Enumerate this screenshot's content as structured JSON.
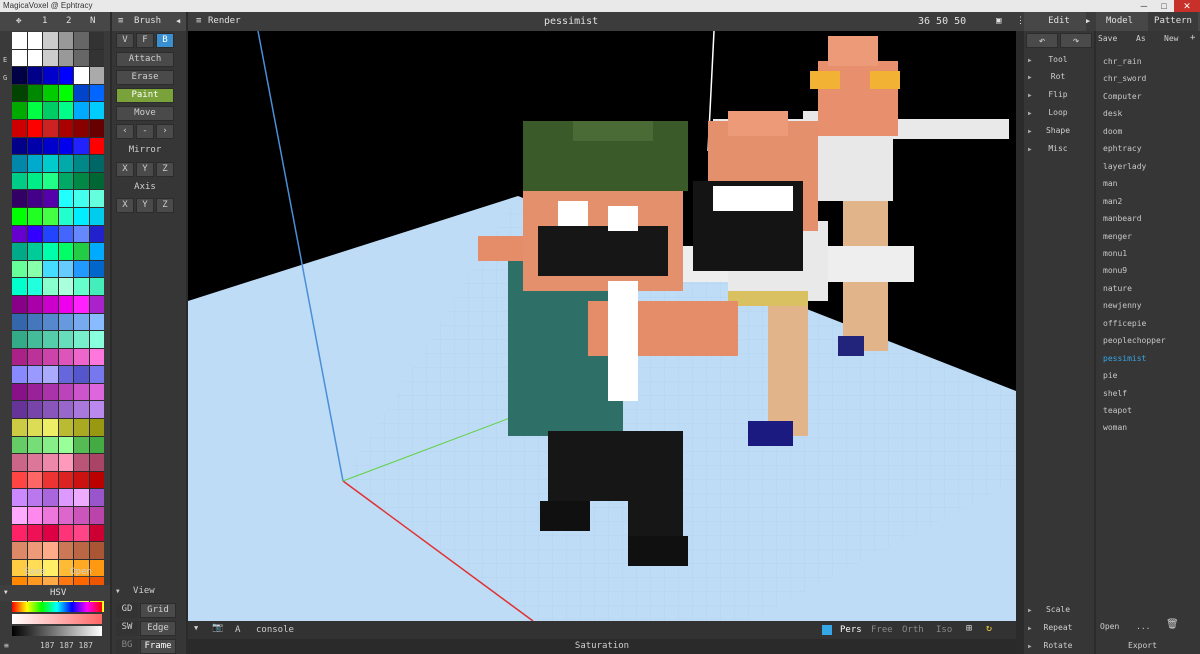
{
  "window": {
    "title": "MagicaVoxel @ Ephtracy",
    "min": "─",
    "max": "□",
    "close": "✕"
  },
  "top_left": {
    "move_icon": "✥",
    "tab1": "1",
    "tab2": "2",
    "tab_n": "N"
  },
  "side_letters": {
    "e": "E",
    "g": "G"
  },
  "brush": {
    "title": "Brush",
    "modes": [
      "V",
      "F",
      "B"
    ],
    "actions": [
      "Attach",
      "Erase",
      "Paint",
      "Move"
    ],
    "nav": [
      "‹",
      "-",
      "›"
    ],
    "mirror_label": "Mirror",
    "mirror_axes": [
      "X",
      "Y",
      "Z"
    ],
    "axis_label": "Axis",
    "axis_axes": [
      "X",
      "Y",
      "Z"
    ]
  },
  "palette": {
    "save": "Save",
    "open": "Open",
    "mode": "HSV",
    "rgb": "187 187 187",
    "colors": [
      "#ffffff",
      "#ffffff",
      "#cccccc",
      "#999999",
      "#666666",
      "#333333",
      "#ffffff",
      "#ffffff",
      "#cccccc",
      "#999999",
      "#666666",
      "#333333",
      "#000044",
      "#000088",
      "#0000cc",
      "#0000ff",
      "#ffffff",
      "#aaaaaa",
      "#004400",
      "#008800",
      "#00cc00",
      "#00ff00",
      "#0044cc",
      "#0066ff",
      "#00aa00",
      "#00ff44",
      "#00cc66",
      "#00ff88",
      "#00aaff",
      "#00ccff",
      "#cc0000",
      "#ff0000",
      "#cc2222",
      "#aa0000",
      "#880000",
      "#660000",
      "#000088",
      "#0000aa",
      "#0000cc",
      "#0000ee",
      "#2222ff",
      "#ff0000",
      "#0088aa",
      "#00aacc",
      "#00cccc",
      "#00aaaa",
      "#008888",
      "#006666",
      "#00cc88",
      "#00ee88",
      "#22ff88",
      "#00aa66",
      "#008844",
      "#006633",
      "#330066",
      "#440088",
      "#5500aa",
      "#22ffff",
      "#44ffee",
      "#66ffdd",
      "#00ff00",
      "#22ff22",
      "#44ff44",
      "#22ffcc",
      "#00eeff",
      "#00ccee",
      "#6600cc",
      "#3300ff",
      "#2244ff",
      "#4466ff",
      "#6688ff",
      "#2222cc",
      "#00aa88",
      "#00cc99",
      "#00ffaa",
      "#00ff66",
      "#22cc44",
      "#00aaff",
      "#66ff99",
      "#88ffaa",
      "#44ddff",
      "#66ccff",
      "#2299ff",
      "#0066cc",
      "#00ffcc",
      "#22ffdd",
      "#88ffcc",
      "#aaffdd",
      "#66ffcc",
      "#44eebb",
      "#880088",
      "#aa00aa",
      "#cc00cc",
      "#ee00ee",
      "#ff22ff",
      "#aa22cc",
      "#3366aa",
      "#4477bb",
      "#5588cc",
      "#6699dd",
      "#77aaee",
      "#88bbff",
      "#33aa88",
      "#44bb99",
      "#55ccaa",
      "#66ddbb",
      "#77eecc",
      "#88ffdd",
      "#aa2288",
      "#bb3399",
      "#cc44aa",
      "#dd55bb",
      "#ee66cc",
      "#ff77dd",
      "#8888ff",
      "#9999ff",
      "#aaaaff",
      "#6666dd",
      "#5555cc",
      "#7777ee",
      "#881188",
      "#992299",
      "#aa33aa",
      "#bb44bb",
      "#cc55cc",
      "#dd66dd",
      "#663399",
      "#7744aa",
      "#8855bb",
      "#9966cc",
      "#aa77dd",
      "#bb88ee",
      "#cccc44",
      "#dddd55",
      "#eeee66",
      "#bbbb33",
      "#aaaa22",
      "#999911",
      "#66cc66",
      "#77dd77",
      "#88ee88",
      "#99ff99",
      "#55bb55",
      "#44aa44",
      "#cc6688",
      "#dd7799",
      "#ee88aa",
      "#ff99bb",
      "#bb5577",
      "#aa4466",
      "#ff4444",
      "#ff6666",
      "#ee3333",
      "#dd2222",
      "#cc1111",
      "#bb0000",
      "#cc88ff",
      "#bb77ee",
      "#aa66dd",
      "#dd99ff",
      "#ee aaff",
      "#9955cc",
      "#ffaaff",
      "#ff88ee",
      "#ee77dd",
      "#dd66cc",
      "#cc55bb",
      "#bb44aa",
      "#ff2266",
      "#ee1155",
      "#dd0044",
      "#ff3377",
      "#ff4488",
      "#cc0033",
      "#dd8866",
      "#ee9977",
      "#ffaa88",
      "#cc7755",
      "#bb6644",
      "#aa5533",
      "#ffcc44",
      "#ffdd55",
      "#ffee66",
      "#ffbb33",
      "#ffaa22",
      "#ff9911",
      "#ff8800",
      "#ff9922",
      "#ffaa44",
      "#ff7711",
      "#ff6600",
      "#ee5500",
      "#ffffcc",
      "#ffffaa",
      "#ffff88",
      "#ffff66",
      "#ffff44",
      "#ffff22"
    ]
  },
  "render": {
    "title": "Render",
    "model_name": "pessimist",
    "dims": "36 50 50"
  },
  "viewport_icons": {
    "layout": "▣",
    "more": "⋮"
  },
  "edit": {
    "title": "Edit",
    "undo": "↶",
    "redo": "↷",
    "items": [
      "Tool",
      "Rot",
      "Flip",
      "Loop",
      "Shape",
      "Misc"
    ],
    "bottom": [
      "Scale",
      "Repeat",
      "Rotate"
    ]
  },
  "model": {
    "title": "Model",
    "pattern": "Pattern",
    "save": "Save",
    "as": "As",
    "new": "New",
    "plus": "+",
    "files": [
      "chr_rain",
      "chr_sword",
      "Computer",
      "desk",
      "doom",
      "ephtracy",
      "layerlady",
      "man",
      "man2",
      "manbeard",
      "menger",
      "monu1",
      "monu9",
      "nature",
      "newjenny",
      "officepie",
      "peoplechopper",
      "pessimist",
      "pie",
      "shelf",
      "teapot",
      "woman"
    ],
    "selected": "pessimist",
    "open": "Open",
    "ellipsis": "...",
    "trash": "🗑",
    "export": "Export"
  },
  "view": {
    "title": "View",
    "rows": [
      [
        "GD",
        "Grid"
      ],
      [
        "SW",
        "Edge"
      ],
      [
        "BG",
        "Frame"
      ]
    ]
  },
  "bottom_bar": {
    "console": "console",
    "a": "A",
    "saturation": "Saturation",
    "cams": [
      "Pers",
      "Free",
      "Orth",
      "Iso"
    ]
  },
  "colors": {
    "accent": "#35a6e6",
    "active_green": "#7aa23a",
    "ground": "#bcdcf5"
  }
}
